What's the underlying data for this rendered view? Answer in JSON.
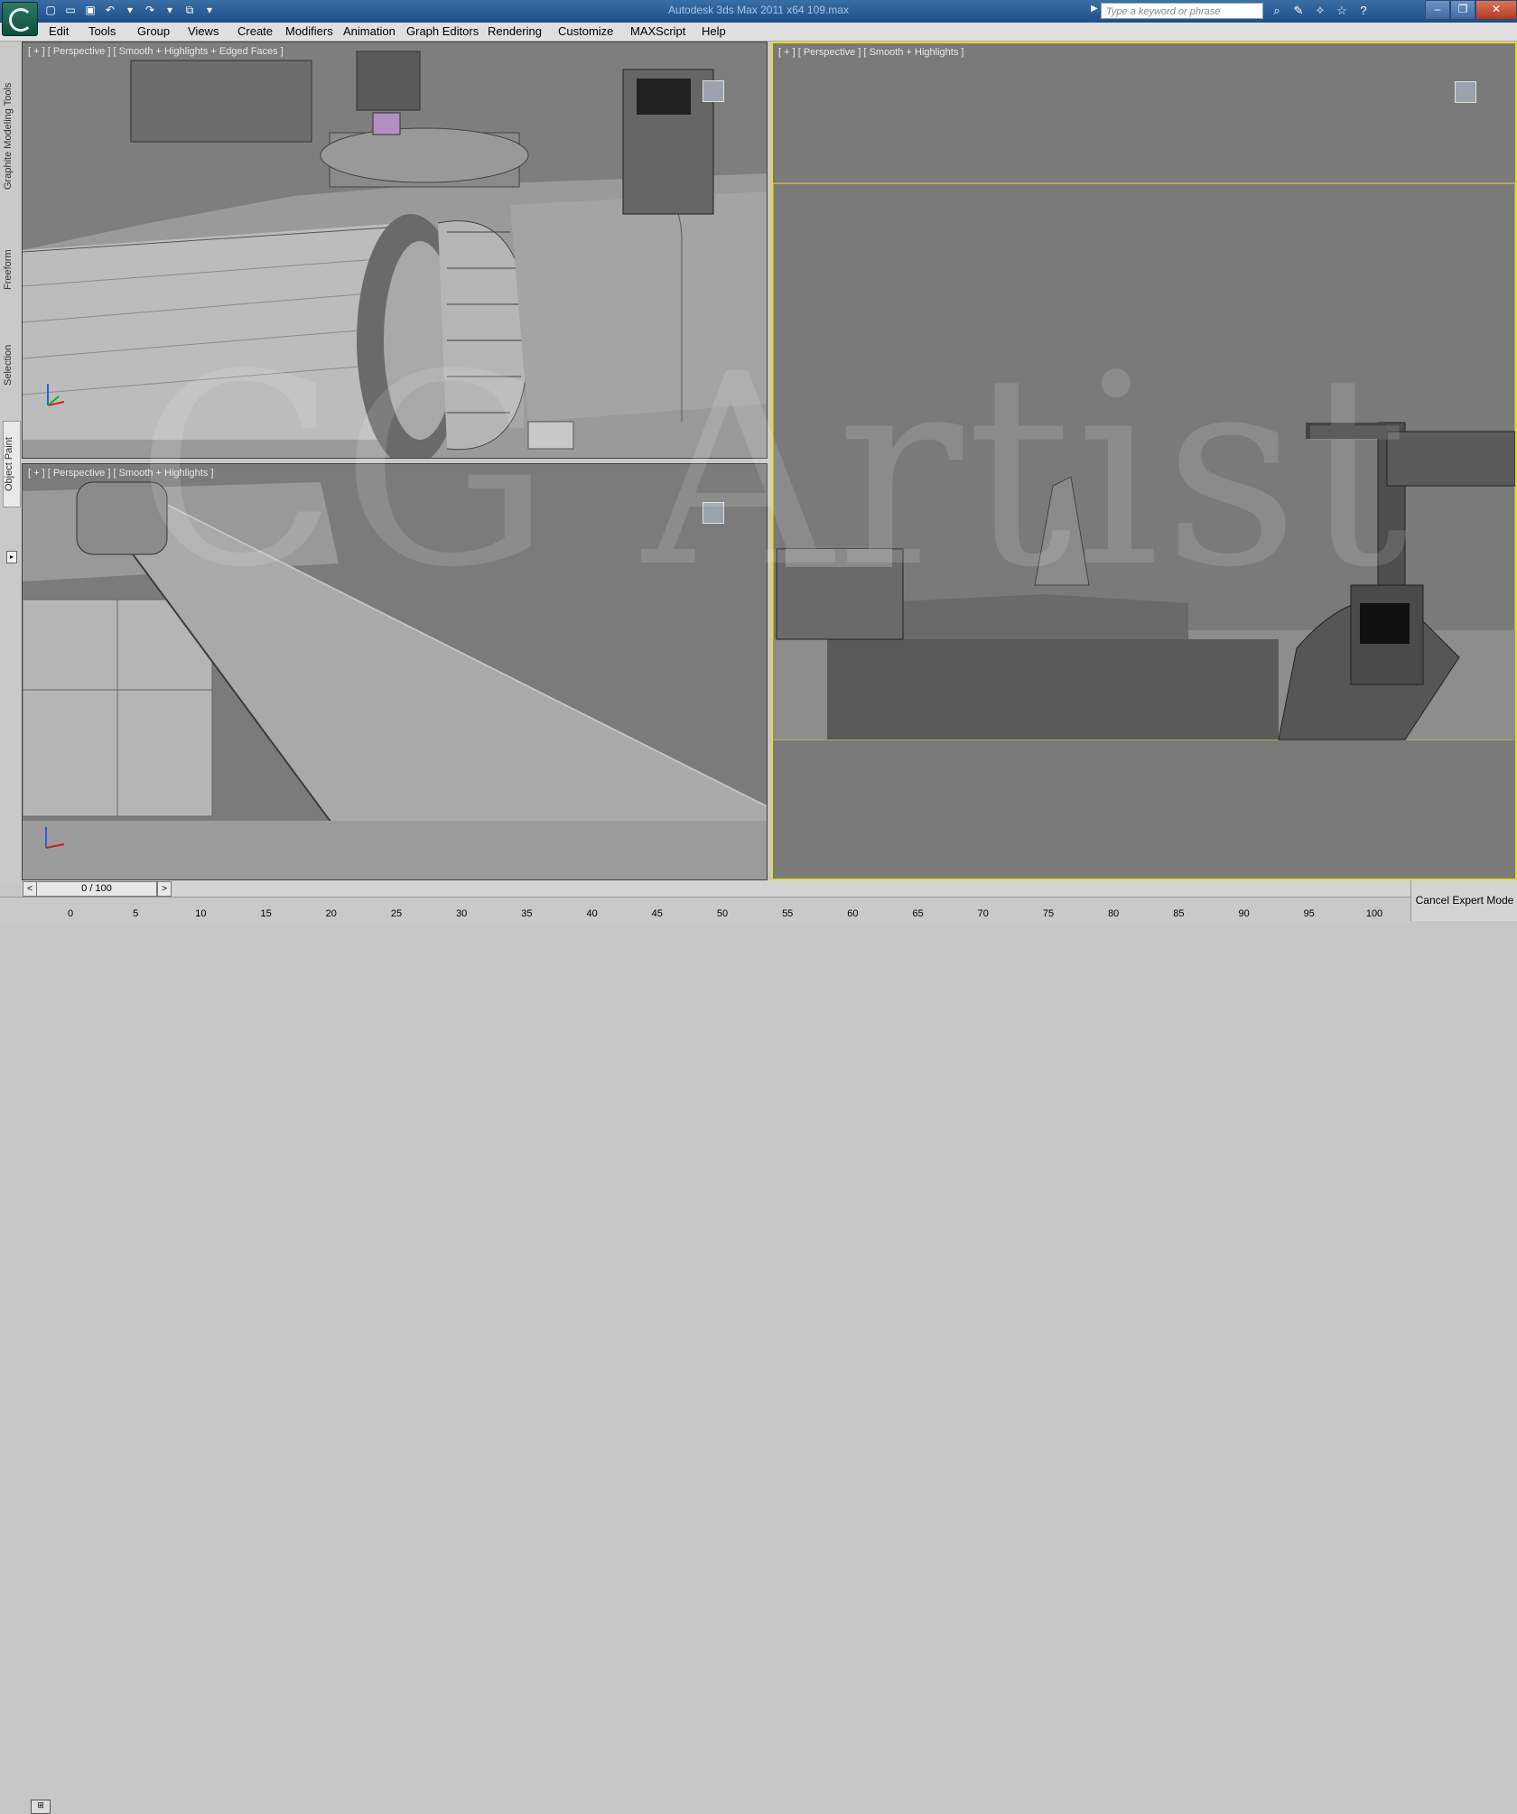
{
  "window": {
    "title": "Autodesk 3ds Max  2011 x64      109.max"
  },
  "search": {
    "placeholder": "Type a keyword or phrase"
  },
  "menu": [
    "Edit",
    "Tools",
    "Group",
    "Views",
    "Create",
    "Modifiers",
    "Animation",
    "Graph Editors",
    "Rendering",
    "Customize",
    "MAXScript",
    "Help"
  ],
  "ribbon_tabs": [
    "Graphite Modeling Tools",
    "Freeform",
    "Selection",
    "Object Paint"
  ],
  "viewports": {
    "top_left": {
      "label": "[ + ] [ Perspective ] [ Smooth + Highlights + Edged Faces ]"
    },
    "bottom_left": {
      "label": "[ + ] [ Perspective ] [ Smooth + Highlights ]"
    },
    "right": {
      "label": "[ + ] [ Perspective ] [ Smooth + Highlights ]"
    }
  },
  "watermark": "CG Artist",
  "timeline": {
    "frame": "0 / 100",
    "prev": "<",
    "next": ">"
  },
  "track": {
    "ticks": [
      "0",
      "5",
      "10",
      "15",
      "20",
      "25",
      "30",
      "35",
      "40",
      "45",
      "50",
      "55",
      "60",
      "65",
      "70",
      "75",
      "80",
      "85",
      "90",
      "95",
      "100"
    ]
  },
  "cancel_expert": "Cancel Expert Mode",
  "colors": {
    "active_border": "#e6dc24",
    "viewport_bg": "#7b7b7b",
    "titlebar": "#2b5e97"
  },
  "icons": [
    "new-file-icon",
    "open-icon",
    "save-icon",
    "undo-icon",
    "redo-icon",
    "project-icon",
    "binoculars-icon",
    "tools-icon",
    "favorites-icon",
    "star-icon",
    "help-icon"
  ]
}
